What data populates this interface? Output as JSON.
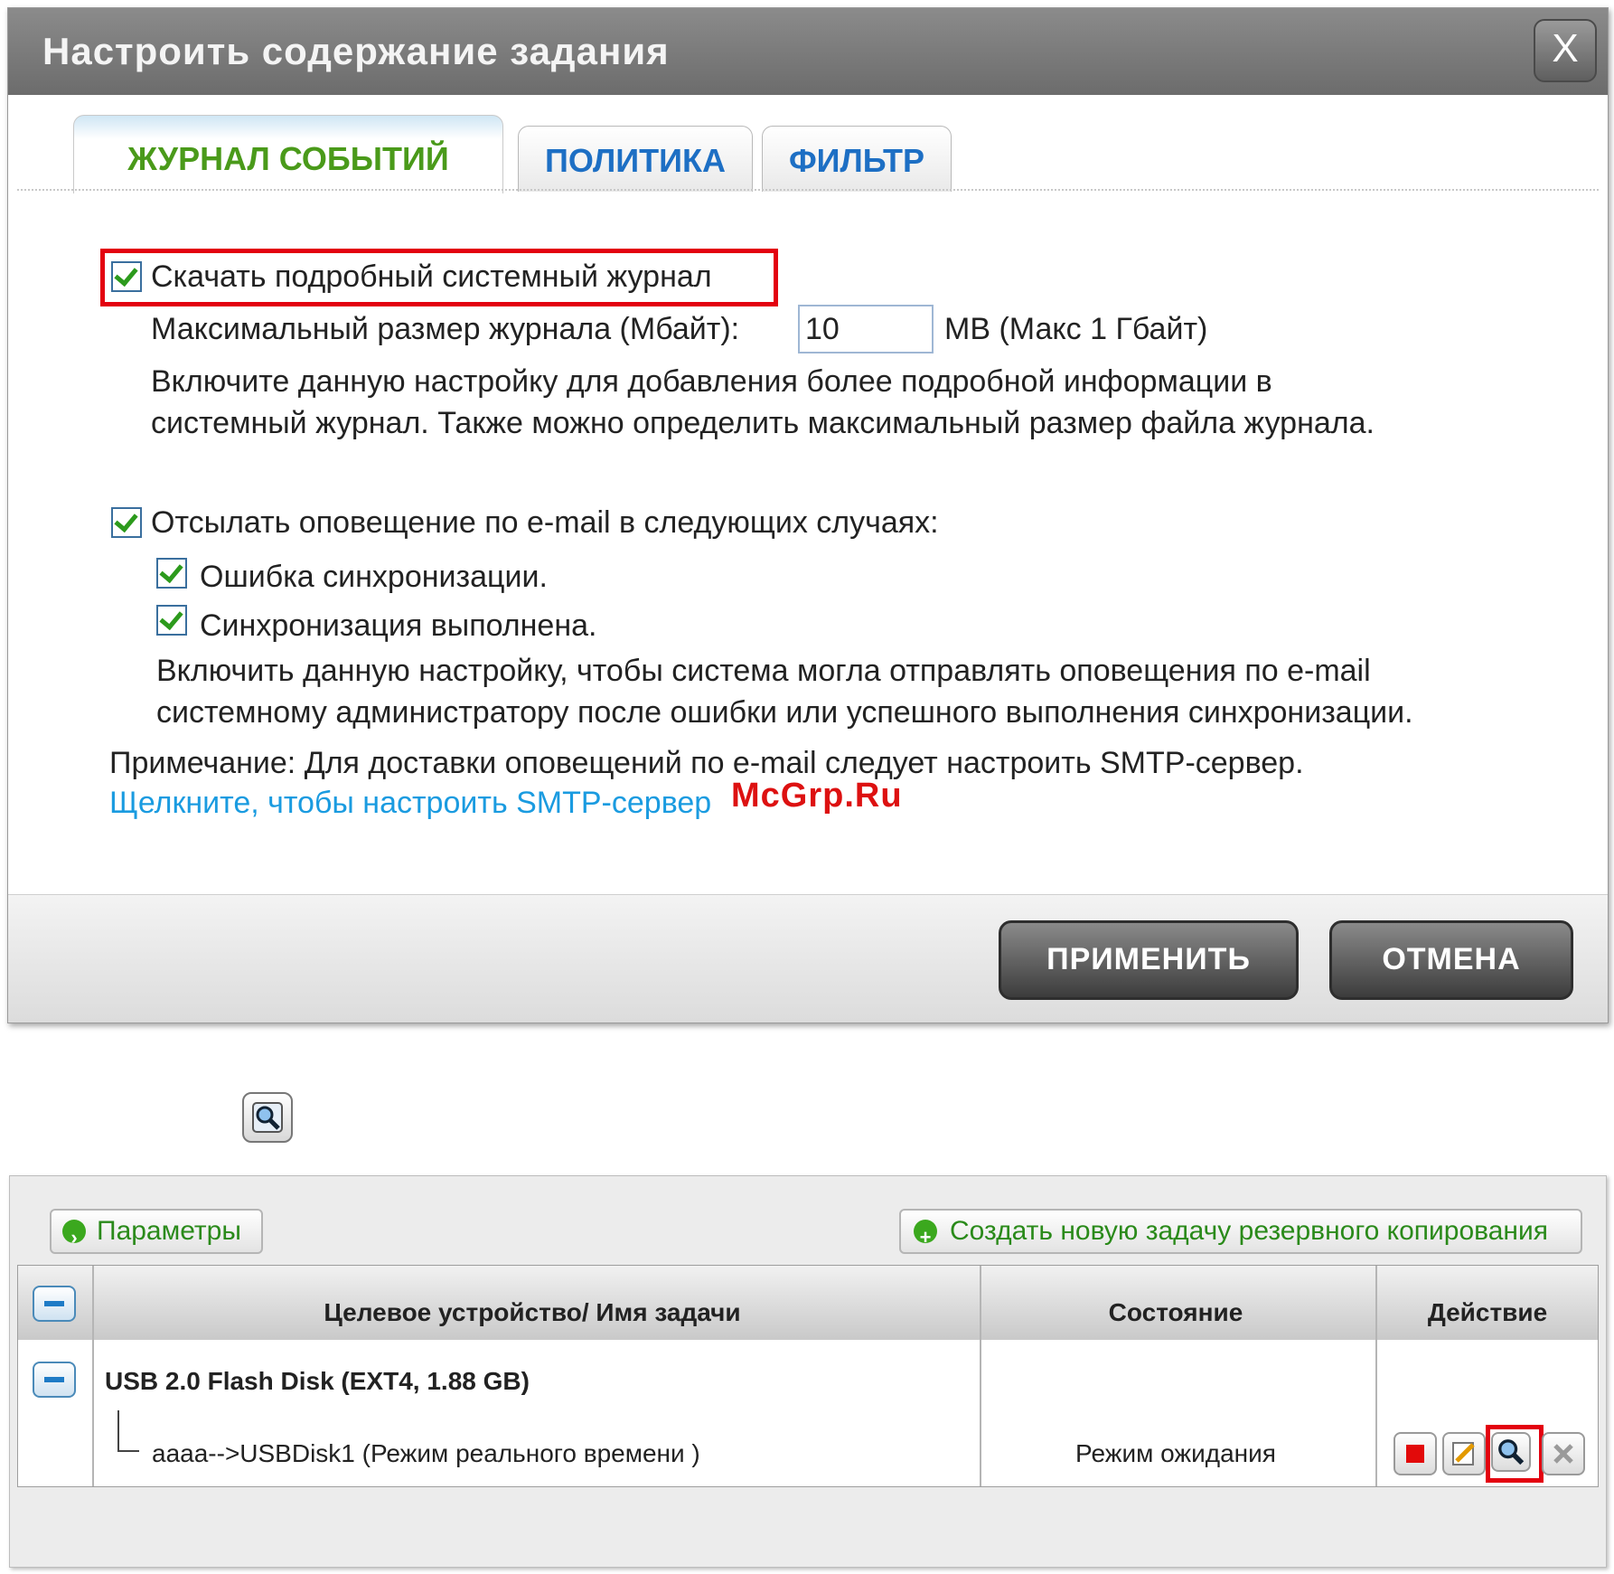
{
  "dialog": {
    "title": "Настроить содержание задания",
    "close_glyph": "X",
    "tabs": [
      {
        "label": "ЖУРНАЛ СОБЫТИЙ",
        "active": true
      },
      {
        "label": "ПОЛИТИКА",
        "active": false
      },
      {
        "label": "ФИЛЬТР",
        "active": false
      }
    ],
    "detailed_log": {
      "checked": true,
      "label": "Скачать подробный системный журнал",
      "max_size_label": "Максимальный размер журнала (Мбайт):",
      "max_size_value": "10",
      "max_size_unit": "MB (Макс 1 Гбайт)",
      "desc_line1": "Включите данную настройку для добавления более подробной информации в",
      "desc_line2": "системный журнал. Также можно определить максимальный размер файла журнала."
    },
    "email_alerts": {
      "checked": true,
      "label": "Отсылать оповещение по e-mail в следующих случаях:",
      "options": [
        {
          "label": "Ошибка синхронизации.",
          "checked": true
        },
        {
          "label": "Синхронизация выполнена.",
          "checked": true
        }
      ],
      "desc_line1": "Включить данную настройку, чтобы система могла отправлять оповещения по e-mail",
      "desc_line2": "системному администратору после ошибки или успешного выполнения синхронизации."
    },
    "note": "Примечание: Для доставки оповещений по e-mail следует настроить SMTP-сервер.",
    "smtp_link": "Щелкните, чтобы настроить SMTP-сервер",
    "watermark": "McGrp.Ru",
    "apply_label": "ПРИМЕНИТЬ",
    "cancel_label": "ОТМЕНА"
  },
  "icons": {
    "magnifier": "magnifier-icon",
    "stop": "stop-icon",
    "edit": "edit-icon",
    "view_log": "view-log-icon",
    "delete": "delete-icon"
  },
  "backup_panel": {
    "params_label": "Параметры",
    "create_label": "Создать новую задачу резервного копирования",
    "columns": [
      "Целевое устройство/ Имя задачи",
      "Состояние",
      "Действие"
    ],
    "device": "USB 2.0 Flash Disk (EXT4, 1.88 GB)",
    "task": {
      "name": "aaaa-->USBDisk1 (Режим реального времени )",
      "status": "Режим ожидания"
    },
    "colors": {
      "highlight": "#e3000f",
      "link": "#1a9be0",
      "active_tab": "#4a9a1a",
      "inactive_tab": "#1d6fc4"
    }
  }
}
